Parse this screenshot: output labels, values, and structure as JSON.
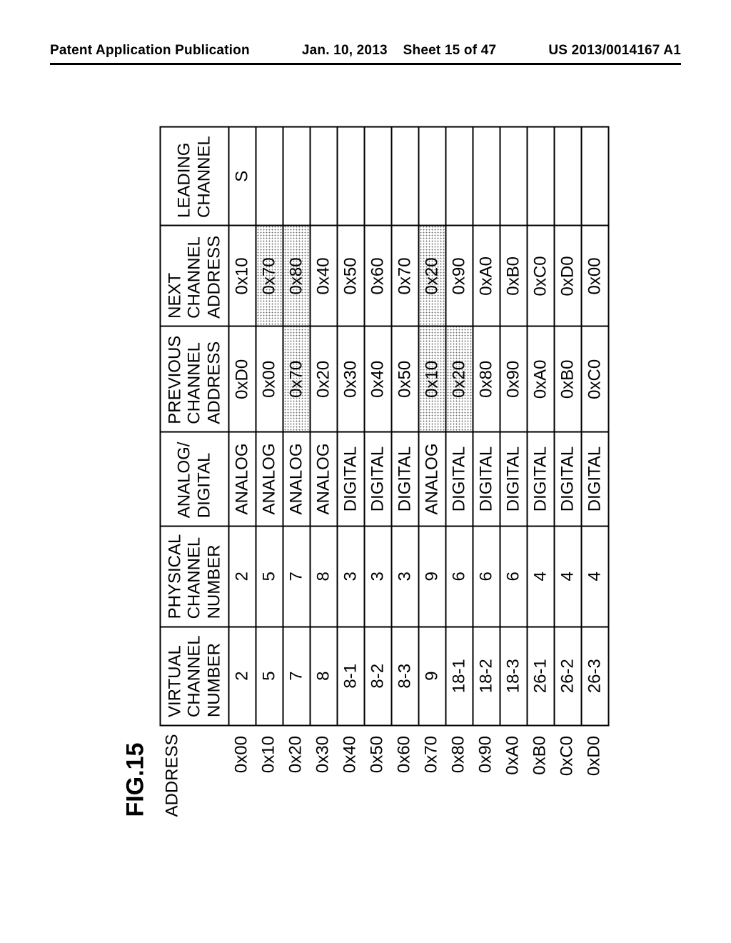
{
  "header": {
    "left": "Patent Application Publication",
    "date": "Jan. 10, 2013",
    "sheet": "Sheet 15 of 47",
    "pubnum": "US 2013/0014167 A1"
  },
  "figure": {
    "label": "FIG.15",
    "address_header": "ADDRESS",
    "columns": {
      "virtual": "VIRTUAL CHANNEL NUMBER",
      "physical": "PHYSICAL CHANNEL NUMBER",
      "ad": "ANALOG/ DIGITAL",
      "prev": "PREVIOUS CHANNEL ADDRESS",
      "next": "NEXT CHANNEL ADDRESS",
      "leading": "LEADING CHANNEL"
    },
    "rows": [
      {
        "addr": "0x00",
        "virtual": "2",
        "physical": "2",
        "ad": "ANALOG",
        "prev": "0xD0",
        "next": "0x10",
        "leading": "S",
        "prev_shaded": false,
        "next_shaded": false
      },
      {
        "addr": "0x10",
        "virtual": "5",
        "physical": "5",
        "ad": "ANALOG",
        "prev": "0x00",
        "next": "0x70",
        "leading": "",
        "prev_shaded": false,
        "next_shaded": true
      },
      {
        "addr": "0x20",
        "virtual": "7",
        "physical": "7",
        "ad": "ANALOG",
        "prev": "0x70",
        "next": "0x80",
        "leading": "",
        "prev_shaded": true,
        "next_shaded": true
      },
      {
        "addr": "0x30",
        "virtual": "8",
        "physical": "8",
        "ad": "ANALOG",
        "prev": "0x20",
        "next": "0x40",
        "leading": "",
        "prev_shaded": false,
        "next_shaded": false
      },
      {
        "addr": "0x40",
        "virtual": "8-1",
        "physical": "3",
        "ad": "DIGITAL",
        "prev": "0x30",
        "next": "0x50",
        "leading": "",
        "prev_shaded": false,
        "next_shaded": false
      },
      {
        "addr": "0x50",
        "virtual": "8-2",
        "physical": "3",
        "ad": "DIGITAL",
        "prev": "0x40",
        "next": "0x60",
        "leading": "",
        "prev_shaded": false,
        "next_shaded": false
      },
      {
        "addr": "0x60",
        "virtual": "8-3",
        "physical": "3",
        "ad": "DIGITAL",
        "prev": "0x50",
        "next": "0x70",
        "leading": "",
        "prev_shaded": false,
        "next_shaded": false
      },
      {
        "addr": "0x70",
        "virtual": "9",
        "physical": "9",
        "ad": "ANALOG",
        "prev": "0x10",
        "next": "0x20",
        "leading": "",
        "prev_shaded": true,
        "next_shaded": true
      },
      {
        "addr": "0x80",
        "virtual": "18-1",
        "physical": "6",
        "ad": "DIGITAL",
        "prev": "0x20",
        "next": "0x90",
        "leading": "",
        "prev_shaded": true,
        "next_shaded": false
      },
      {
        "addr": "0x90",
        "virtual": "18-2",
        "physical": "6",
        "ad": "DIGITAL",
        "prev": "0x80",
        "next": "0xA0",
        "leading": "",
        "prev_shaded": false,
        "next_shaded": false
      },
      {
        "addr": "0xA0",
        "virtual": "18-3",
        "physical": "6",
        "ad": "DIGITAL",
        "prev": "0x90",
        "next": "0xB0",
        "leading": "",
        "prev_shaded": false,
        "next_shaded": false
      },
      {
        "addr": "0xB0",
        "virtual": "26-1",
        "physical": "4",
        "ad": "DIGITAL",
        "prev": "0xA0",
        "next": "0xC0",
        "leading": "",
        "prev_shaded": false,
        "next_shaded": false
      },
      {
        "addr": "0xC0",
        "virtual": "26-2",
        "physical": "4",
        "ad": "DIGITAL",
        "prev": "0xB0",
        "next": "0xD0",
        "leading": "",
        "prev_shaded": false,
        "next_shaded": false
      },
      {
        "addr": "0xD0",
        "virtual": "26-3",
        "physical": "4",
        "ad": "DIGITAL",
        "prev": "0xC0",
        "next": "0x00",
        "leading": "",
        "prev_shaded": false,
        "next_shaded": false
      }
    ]
  },
  "chart_data": {
    "type": "table",
    "title": "FIG.15",
    "columns": [
      "ADDRESS",
      "VIRTUAL CHANNEL NUMBER",
      "PHYSICAL CHANNEL NUMBER",
      "ANALOG/DIGITAL",
      "PREVIOUS CHANNEL ADDRESS",
      "NEXT CHANNEL ADDRESS",
      "LEADING CHANNEL"
    ],
    "rows": [
      [
        "0x00",
        "2",
        "2",
        "ANALOG",
        "0xD0",
        "0x10",
        "S"
      ],
      [
        "0x10",
        "5",
        "5",
        "ANALOG",
        "0x00",
        "0x70",
        ""
      ],
      [
        "0x20",
        "7",
        "7",
        "ANALOG",
        "0x70",
        "0x80",
        ""
      ],
      [
        "0x30",
        "8",
        "8",
        "ANALOG",
        "0x20",
        "0x40",
        ""
      ],
      [
        "0x40",
        "8-1",
        "3",
        "DIGITAL",
        "0x30",
        "0x50",
        ""
      ],
      [
        "0x50",
        "8-2",
        "3",
        "DIGITAL",
        "0x40",
        "0x60",
        ""
      ],
      [
        "0x60",
        "8-3",
        "3",
        "DIGITAL",
        "0x50",
        "0x70",
        ""
      ],
      [
        "0x70",
        "9",
        "9",
        "ANALOG",
        "0x10",
        "0x20",
        ""
      ],
      [
        "0x80",
        "18-1",
        "6",
        "DIGITAL",
        "0x20",
        "0x90",
        ""
      ],
      [
        "0x90",
        "18-2",
        "6",
        "DIGITAL",
        "0x80",
        "0xA0",
        ""
      ],
      [
        "0xA0",
        "18-3",
        "6",
        "DIGITAL",
        "0x90",
        "0xB0",
        ""
      ],
      [
        "0xB0",
        "26-1",
        "4",
        "DIGITAL",
        "0xA0",
        "0xC0",
        ""
      ],
      [
        "0xC0",
        "26-2",
        "4",
        "DIGITAL",
        "0xB0",
        "0xD0",
        ""
      ],
      [
        "0xD0",
        "26-3",
        "4",
        "DIGITAL",
        "0xC0",
        "0x00",
        ""
      ]
    ],
    "shaded_cells": [
      {
        "row": 1,
        "col": "NEXT CHANNEL ADDRESS"
      },
      {
        "row": 2,
        "col": "PREVIOUS CHANNEL ADDRESS"
      },
      {
        "row": 2,
        "col": "NEXT CHANNEL ADDRESS"
      },
      {
        "row": 7,
        "col": "PREVIOUS CHANNEL ADDRESS"
      },
      {
        "row": 7,
        "col": "NEXT CHANNEL ADDRESS"
      },
      {
        "row": 8,
        "col": "PREVIOUS CHANNEL ADDRESS"
      }
    ]
  }
}
